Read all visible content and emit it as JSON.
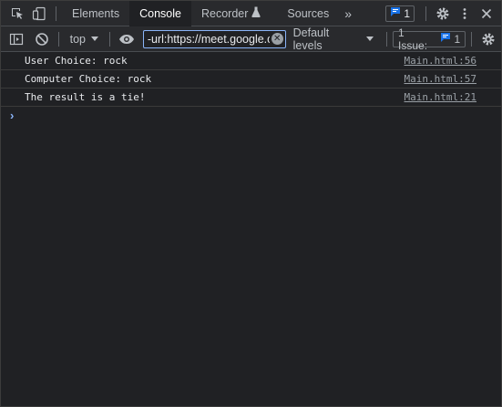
{
  "tabs": [
    {
      "label": "Elements"
    },
    {
      "label": "Console",
      "active": true
    },
    {
      "label": "Recorder"
    },
    {
      "label": "Sources"
    }
  ],
  "more_tabs_label": "»",
  "issues_count": "1",
  "toolbar": {
    "context_label": "top",
    "filter_value": "-url:https://meet.google.com",
    "levels_label": "Default levels",
    "issues_label": "1 Issue:",
    "issues_count": "1"
  },
  "log": [
    {
      "message": "User Choice: rock",
      "source": "Main.html:56"
    },
    {
      "message": "Computer Choice: rock",
      "source": "Main.html:57"
    },
    {
      "message": "The result is a tie!",
      "source": "Main.html:21"
    }
  ],
  "prompt_symbol": "›",
  "colors": {
    "accent": "#8ab4f8",
    "badge_blue": "#1a73e8",
    "background": "#202124",
    "toolbar": "#292a2d"
  }
}
